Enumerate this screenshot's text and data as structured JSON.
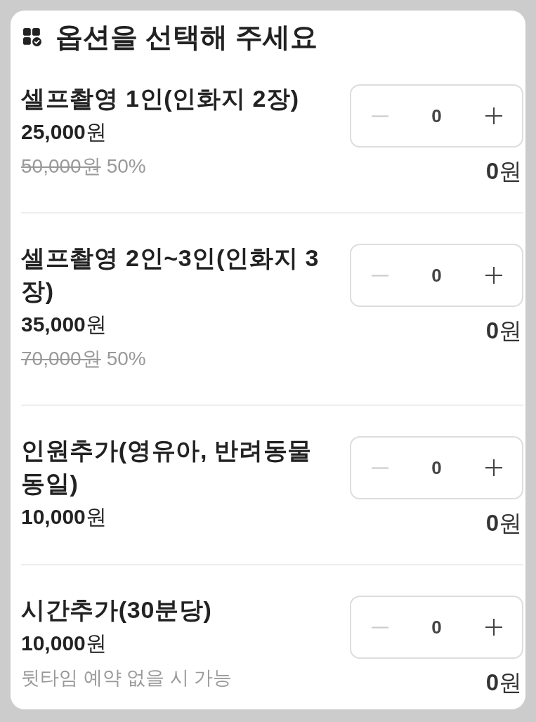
{
  "header": {
    "title": "옵션을 선택해 주세요"
  },
  "options": [
    {
      "name": "셀프촬영 1인(인화지 2장)",
      "price": "**25,000**원",
      "original_price": "50,000원",
      "discount": "50%",
      "quantity": "0",
      "decrease_disabled": true,
      "total": "**0**원"
    },
    {
      "name": "셀프촬영 2인~3인(인화지 3장)",
      "price": "**35,000**원",
      "original_price": "70,000원",
      "discount": "50%",
      "quantity": "0",
      "decrease_disabled": true,
      "total": "**0**원"
    },
    {
      "name": "인원추가(영유아, 반려동물 동일)",
      "price": "**10,000**원",
      "quantity": "0",
      "decrease_disabled": true,
      "total": "**0**원"
    },
    {
      "name": "시간추가(30분당)",
      "price": "**10,000**원",
      "note": "뒷타임 예약 없을 시 가능",
      "quantity": "0",
      "decrease_disabled": true,
      "total": "**0**원"
    }
  ]
}
